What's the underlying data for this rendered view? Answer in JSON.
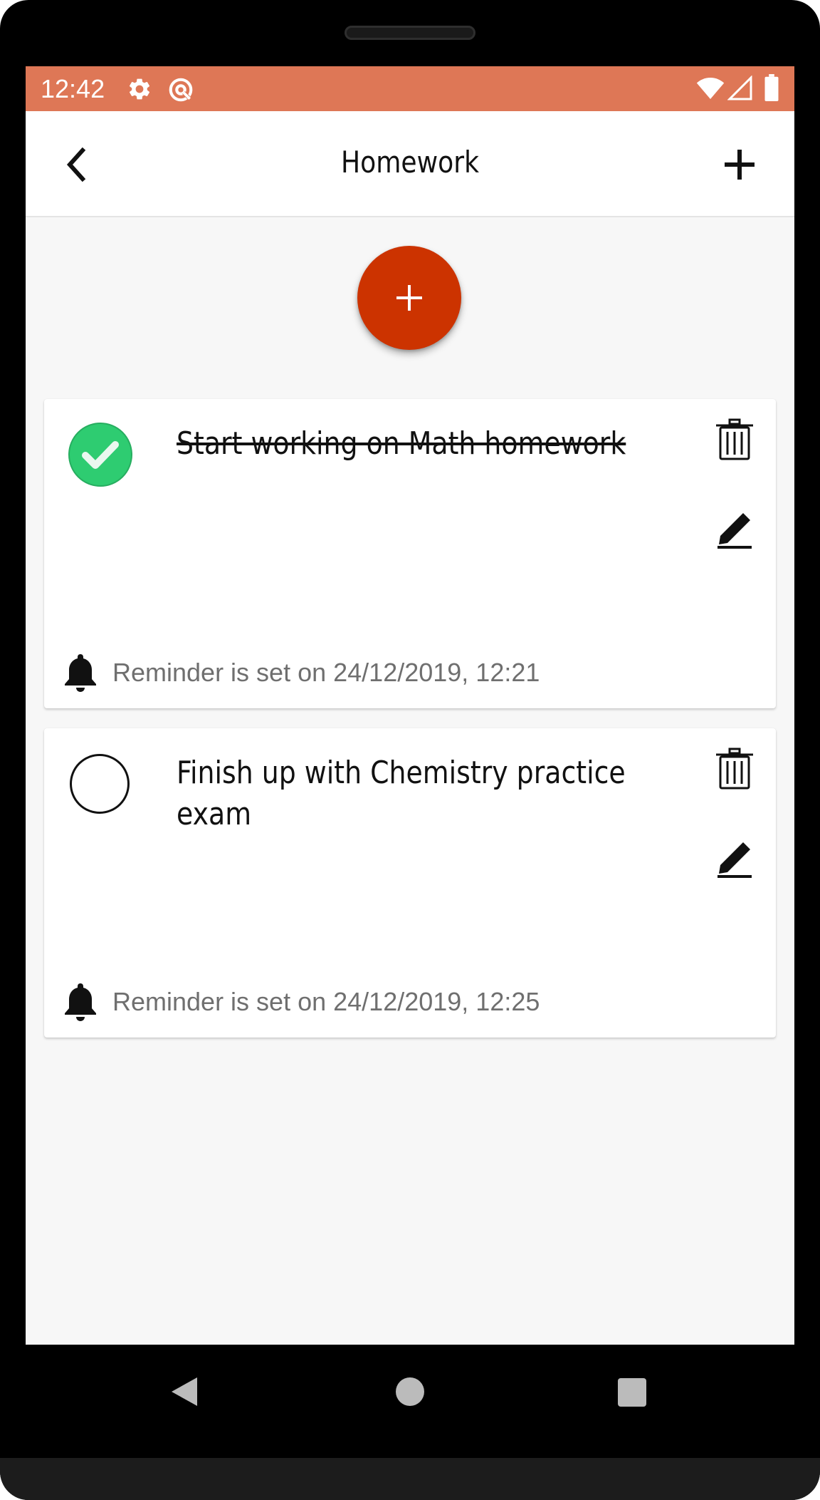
{
  "status_bar": {
    "time": "12:42",
    "icons": [
      "gear-icon",
      "sync-icon",
      "wifi-icon",
      "signal-icon",
      "battery-icon"
    ],
    "background_color": "#de7756"
  },
  "app_bar": {
    "title": "Homework",
    "back_icon": "chevron-left-icon",
    "add_icon": "plus-icon"
  },
  "fab": {
    "icon": "plus-icon",
    "color": "#cc3300"
  },
  "tasks": [
    {
      "text": "Start working on Math homework",
      "completed": true,
      "reminder": "Reminder is set on 24/12/2019, 12:21",
      "icons": [
        "check-circle-icon",
        "trash-icon",
        "pencil-icon",
        "bell-icon"
      ]
    },
    {
      "text": "Finish up with Chemistry practice exam",
      "completed": false,
      "reminder": "Reminder is set on 24/12/2019, 12:25",
      "icons": [
        "empty-circle-icon",
        "trash-icon",
        "pencil-icon",
        "bell-icon"
      ]
    }
  ],
  "nav_bar": {
    "icons": [
      "nav-back-icon",
      "nav-home-icon",
      "nav-recents-icon"
    ]
  }
}
